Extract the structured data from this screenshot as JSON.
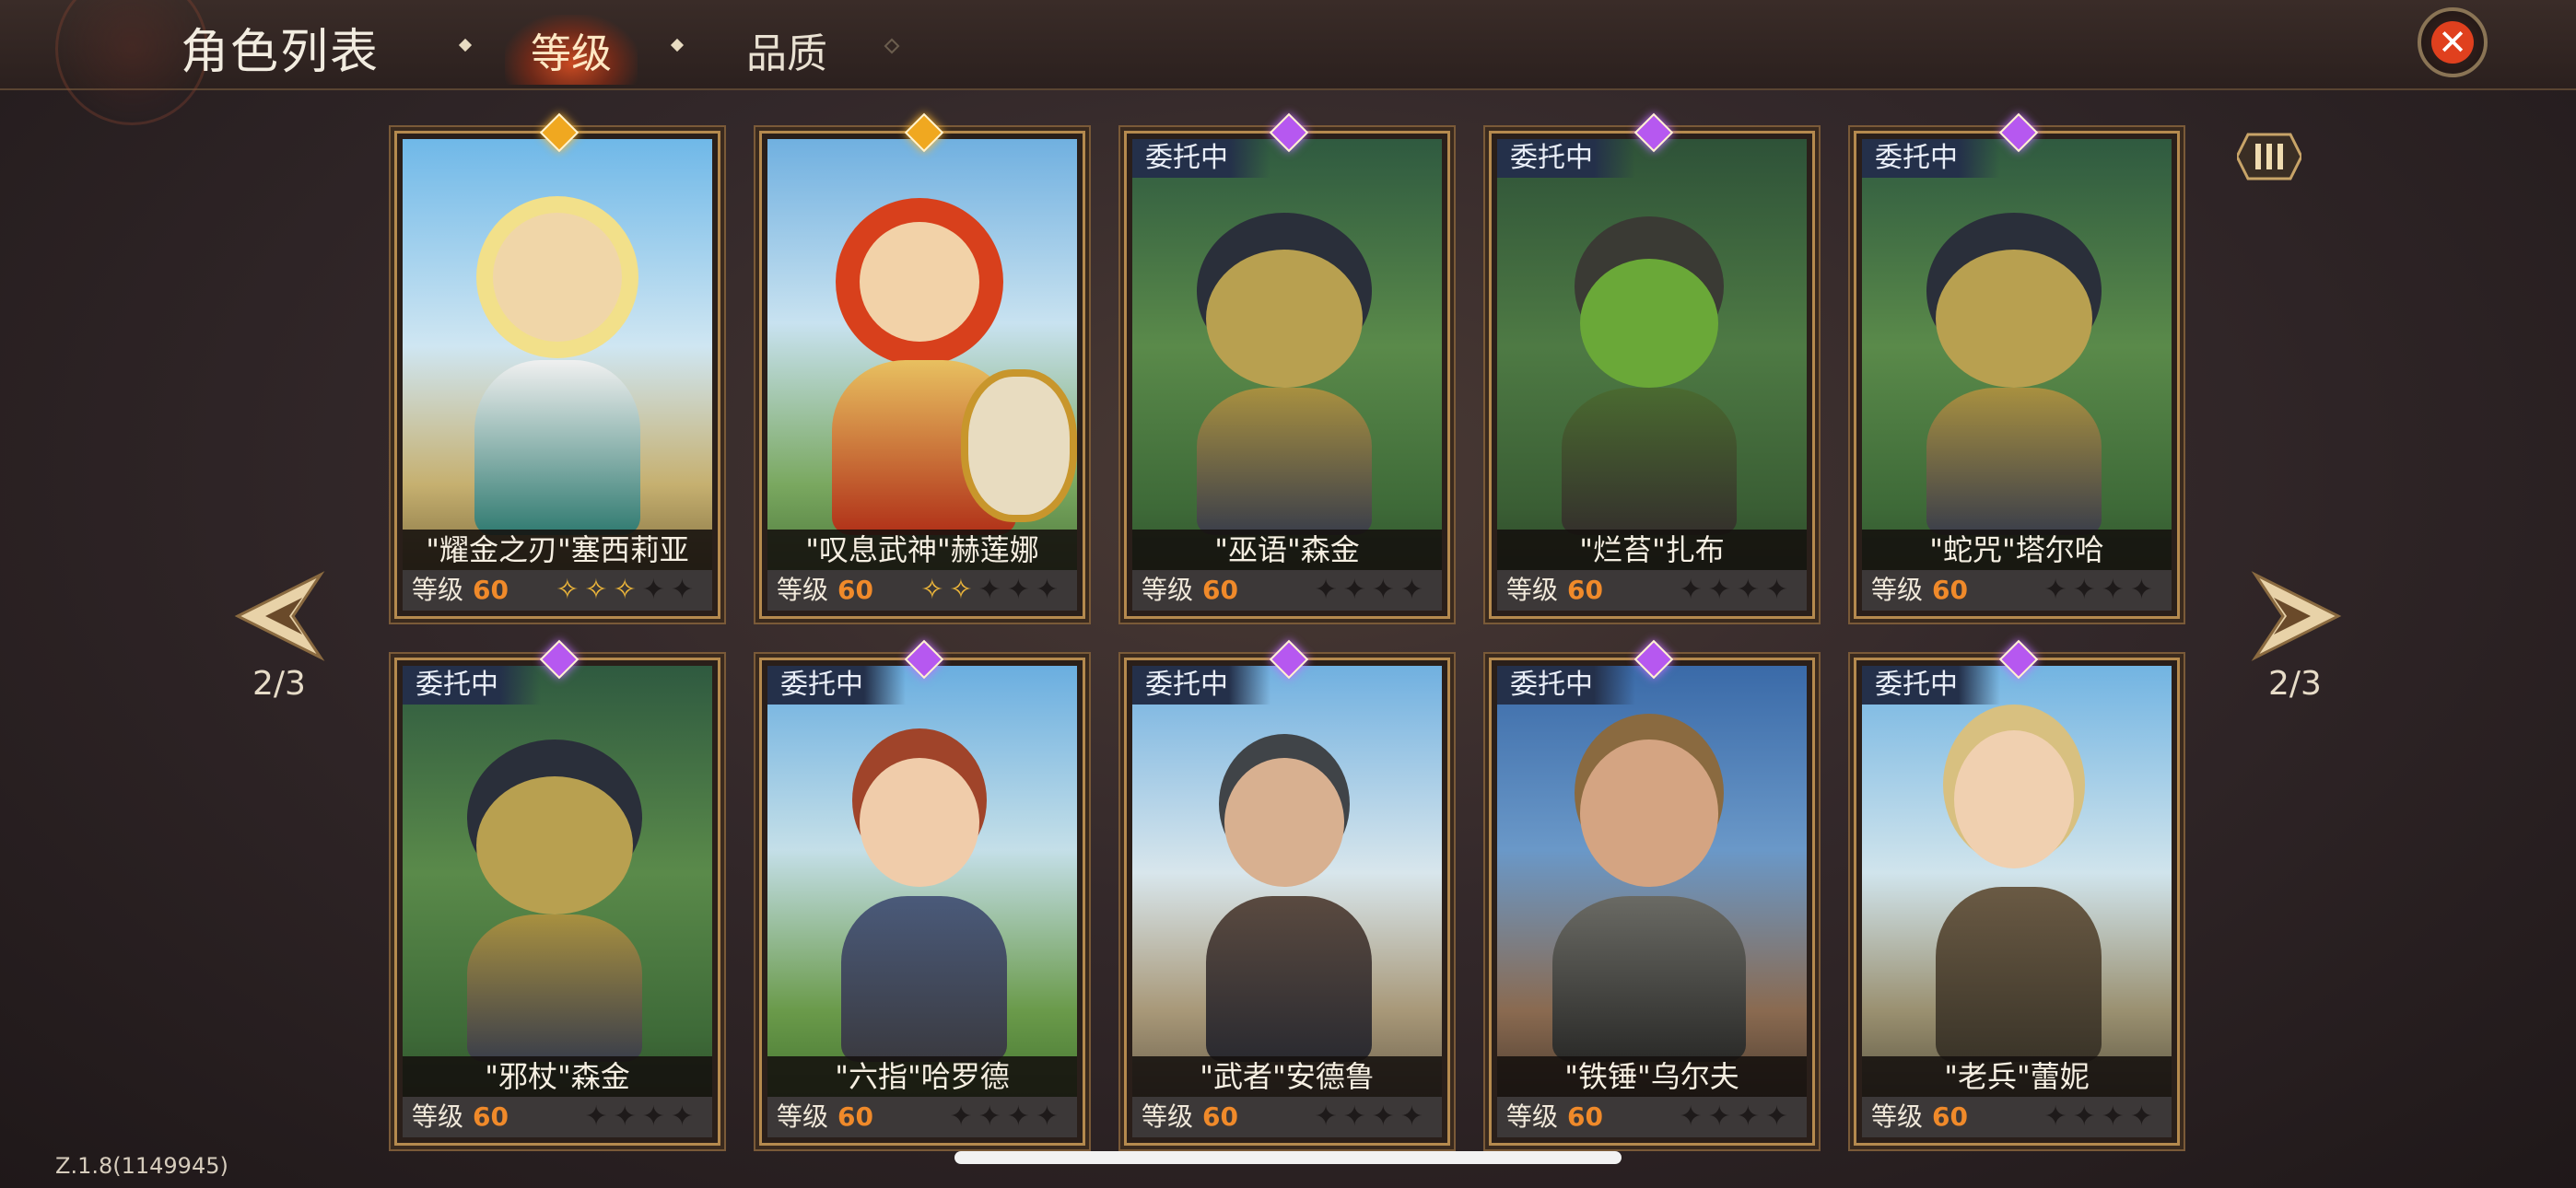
{
  "header": {
    "title": "角色列表",
    "tabs": [
      {
        "label": "等级",
        "active": true
      },
      {
        "label": "品质",
        "active": false
      }
    ],
    "close_icon": "close-x-icon"
  },
  "pagination": {
    "left": "2/3",
    "right": "2/3"
  },
  "level_label": "等级",
  "cards": [
    {
      "name": "\"耀金之刃\"塞西莉亚",
      "badge": "",
      "level": "60",
      "gem": "gold",
      "stars_on": 3,
      "stars_total": 5,
      "accent": "#d8b050"
    },
    {
      "name": "\"叹息武神\"赫莲娜",
      "badge": "",
      "level": "60",
      "gem": "gold",
      "stars_on": 2,
      "stars_total": 5,
      "accent": "#d04020"
    },
    {
      "name": "\"巫语\"森金",
      "badge": "委托中",
      "level": "60",
      "gem": "purple",
      "stars_on": 0,
      "stars_total": 4,
      "accent": "#a89040"
    },
    {
      "name": "\"烂苔\"扎布",
      "badge": "委托中",
      "level": "60",
      "gem": "purple",
      "stars_on": 0,
      "stars_total": 4,
      "accent": "#5a9a30"
    },
    {
      "name": "\"蛇咒\"塔尔哈",
      "badge": "委托中",
      "level": "60",
      "gem": "purple",
      "stars_on": 0,
      "stars_total": 4,
      "accent": "#a89040"
    },
    {
      "name": "\"邪杖\"森金",
      "badge": "委托中",
      "level": "60",
      "gem": "purple",
      "stars_on": 0,
      "stars_total": 4,
      "accent": "#a89040"
    },
    {
      "name": "\"六指\"哈罗德",
      "badge": "委托中",
      "level": "60",
      "gem": "purple",
      "stars_on": 0,
      "stars_total": 4,
      "accent": "#a0502a"
    },
    {
      "name": "\"武者\"安德鲁",
      "badge": "委托中",
      "level": "60",
      "gem": "purple",
      "stars_on": 0,
      "stars_total": 4,
      "accent": "#505050"
    },
    {
      "name": "\"铁锤\"乌尔夫",
      "badge": "委托中",
      "level": "60",
      "gem": "purple",
      "stars_on": 0,
      "stars_total": 4,
      "accent": "#806040"
    },
    {
      "name": "\"老兵\"蕾妮",
      "badge": "委托中",
      "level": "60",
      "gem": "purple",
      "stars_on": 0,
      "stars_total": 4,
      "accent": "#d8c080"
    }
  ],
  "version": "Z.1.8(1149945)"
}
